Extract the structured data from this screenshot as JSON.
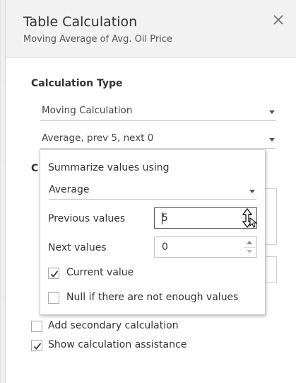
{
  "dialog": {
    "title": "Table Calculation",
    "subtitle": "Moving Average of Avg. Oil Price"
  },
  "calculation_type": {
    "label": "Calculation Type",
    "type_value": "Moving Calculation",
    "summary_value": "Average, prev 5, next 0"
  },
  "compute_using_label_partial": "C",
  "popup": {
    "summarize_label": "Summarize values using",
    "summarize_value": "Average",
    "previous_label": "Previous values",
    "previous_value": "5",
    "next_label": "Next values",
    "next_value": "0",
    "current_value_label": "Current value",
    "current_value_checked": true,
    "null_label": "Null if there are not enough values",
    "null_checked": false
  },
  "options": {
    "secondary_label": "Add secondary calculation",
    "secondary_checked": false,
    "assistance_label": "Show calculation assistance",
    "assistance_checked": true
  },
  "icons": [
    "close-icon",
    "checkmark-icon",
    "dropdown-caret-icon",
    "spinner-up-icon",
    "spinner-down-icon",
    "resize-cursor-icon"
  ]
}
